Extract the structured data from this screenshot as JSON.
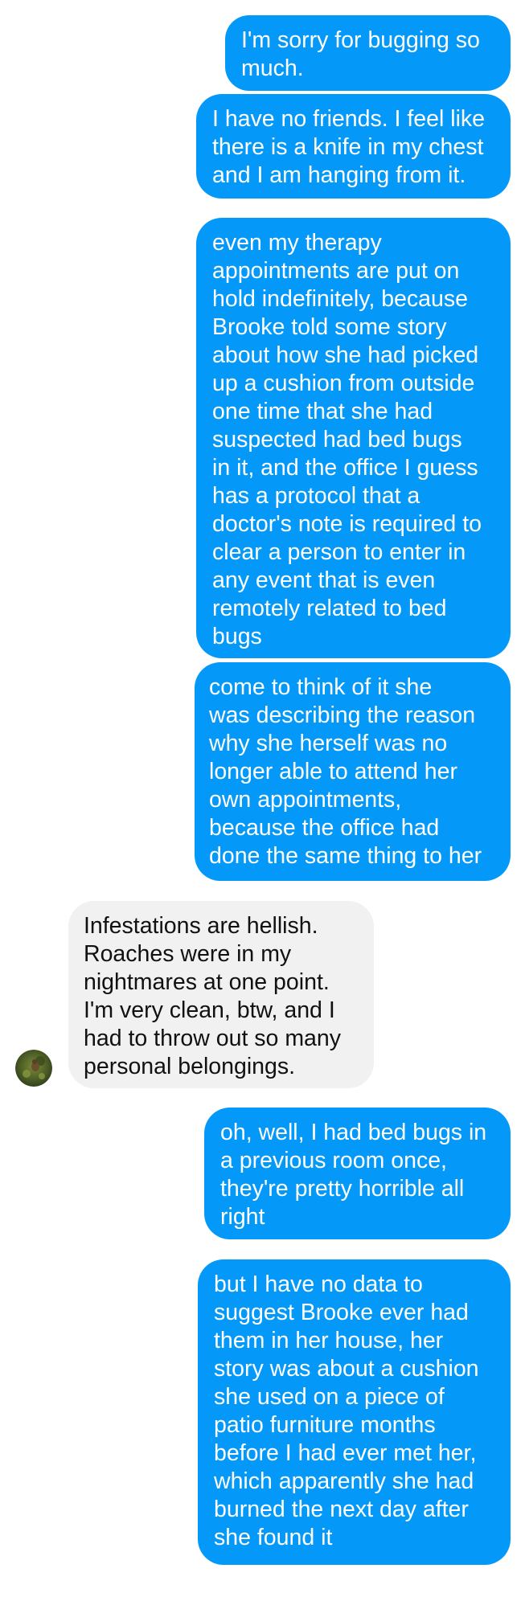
{
  "theme": {
    "outgoing_bubble_color": "#0499f9",
    "incoming_bubble_color": "#f1f1f1",
    "outgoing_text_color": "#ffffff",
    "incoming_text_color": "#111111"
  },
  "messages": [
    {
      "sender": "me",
      "text": "I'm sorry for bugging so\nmuch."
    },
    {
      "sender": "me",
      "text": "I have no friends. I feel like\nthere is a knife in my chest\nand I am hanging from it."
    },
    {
      "sender": "me",
      "text": "even my therapy\nappointments are put on\nhold indefinitely, because\nBrooke told some story\nabout how she had picked\nup a cushion from outside\none time that she had\nsuspected had bed bugs\nin it, and the office I guess\nhas a protocol that a\ndoctor's note is required to\nclear a person to enter in\nany event that is even\nremotely related to bed\nbugs"
    },
    {
      "sender": "me",
      "text": "come to think of it she\nwas describing the reason\nwhy she herself was no\nlonger able to attend her\nown appointments,\nbecause the office had\ndone the same thing to her"
    },
    {
      "sender": "them",
      "text": "Infestations are hellish.\nRoaches were in my\nnightmares at one point.\nI'm very clean, btw, and I\nhad to throw out so many\npersonal belongings.",
      "avatar_icon": "contact-avatar"
    },
    {
      "sender": "me",
      "text": "oh, well, I had bed bugs in\na previous room once,\nthey're pretty horrible all\nright"
    },
    {
      "sender": "me",
      "text": "but I have no data to\nsuggest Brooke ever had\nthem in her house, her\nstory was about a cushion\nshe used on a piece of\npatio furniture months\nbefore I had ever met her,\nwhich apparently she had\nburned the next day after\nshe found it"
    }
  ]
}
